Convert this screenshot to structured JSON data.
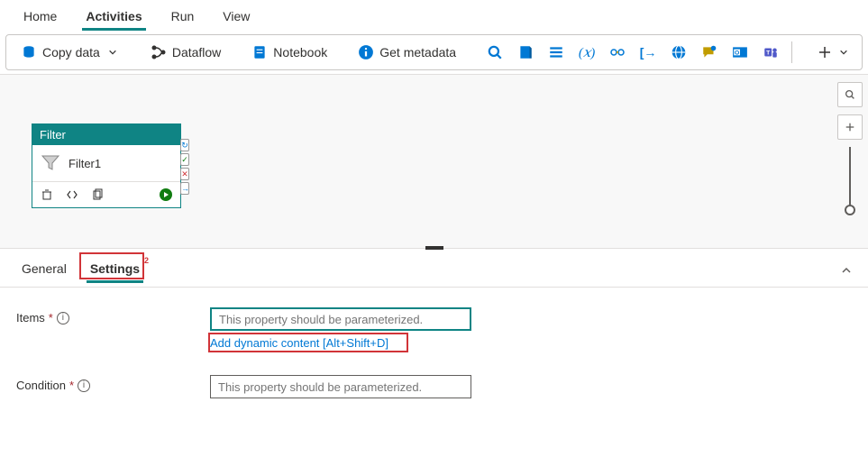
{
  "topTabs": {
    "home": "Home",
    "activities": "Activities",
    "run": "Run",
    "view": "View"
  },
  "toolbar": {
    "copyData": "Copy data",
    "dataflow": "Dataflow",
    "notebook": "Notebook",
    "getMetadata": "Get metadata"
  },
  "node": {
    "type": "Filter",
    "name": "Filter1"
  },
  "configTabs": {
    "general": "General",
    "settings": "Settings",
    "settingsBadge": "2"
  },
  "form": {
    "items": {
      "label": "Items",
      "placeholder": "This property should be parameterized.",
      "dynamicLink": "Add dynamic content [Alt+Shift+D]"
    },
    "condition": {
      "label": "Condition",
      "placeholder": "This property should be parameterized."
    }
  }
}
